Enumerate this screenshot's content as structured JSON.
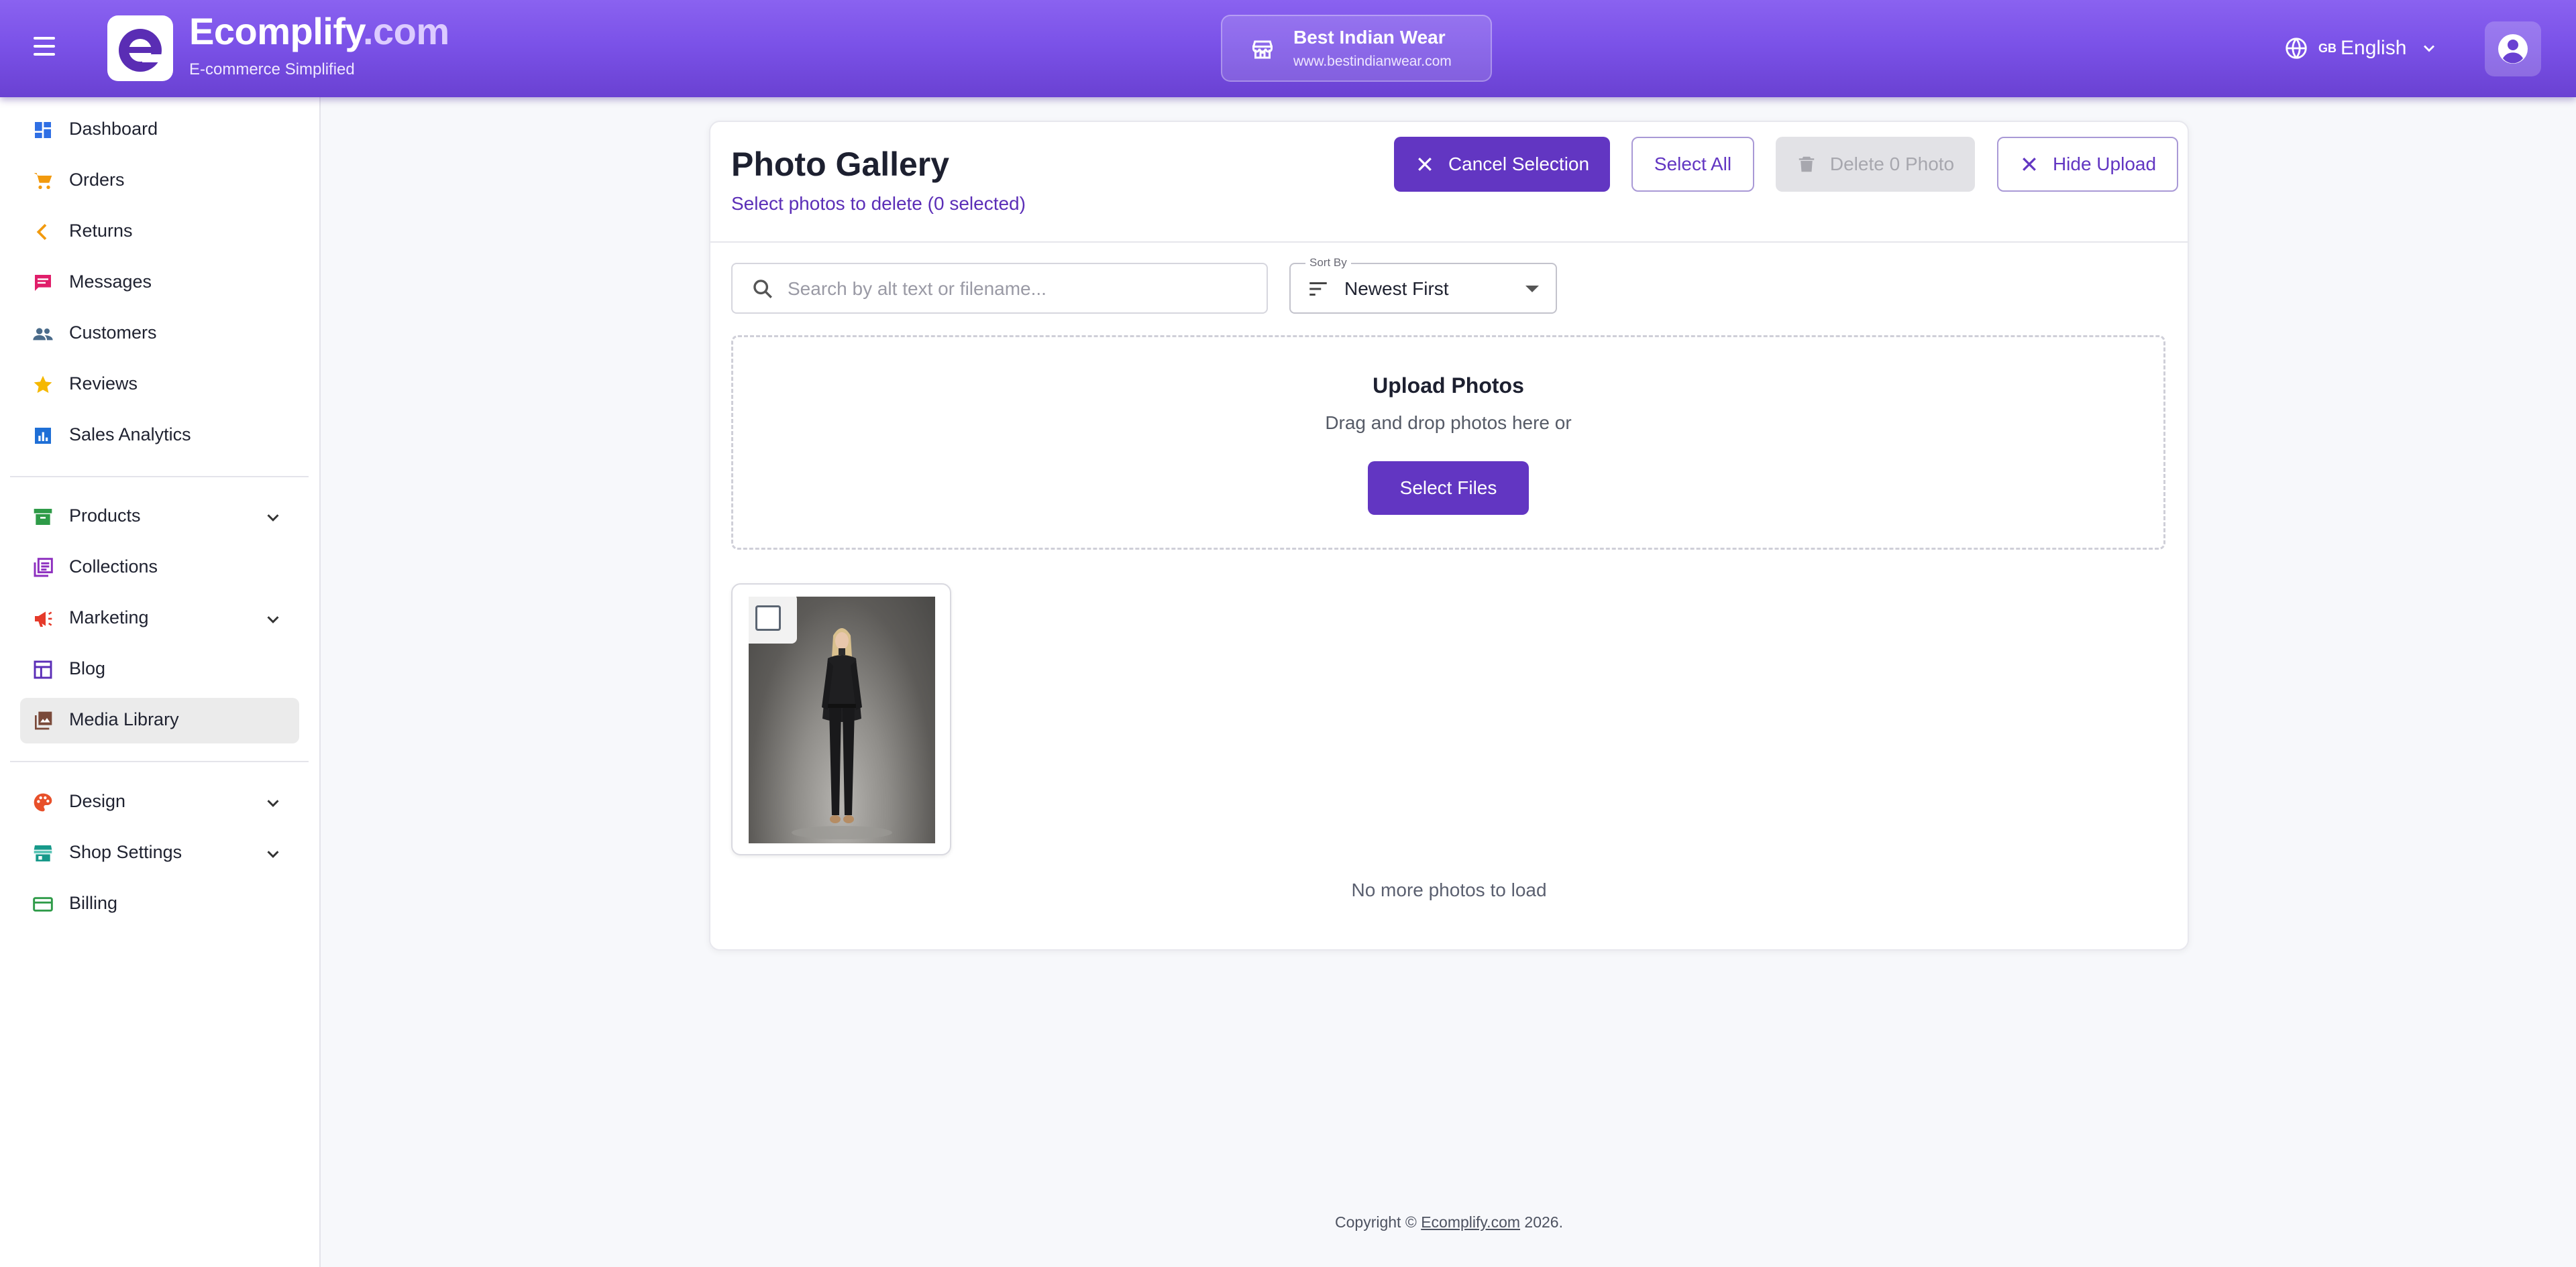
{
  "header": {
    "brand_main": "Ecomplify",
    "brand_domain": ".com",
    "tagline": "E-commerce Simplified",
    "store_name": "Best Indian Wear",
    "store_url": "www.bestindianwear.com",
    "language_flag": "GB",
    "language": "English",
    "icons": [
      "menu-icon",
      "logo-icon",
      "store-icon",
      "globe-icon",
      "chevron-down-icon",
      "account-circle-icon"
    ]
  },
  "sidebar": {
    "items": [
      {
        "label": "Dashboard",
        "icon": "dashboard-icon"
      },
      {
        "label": "Orders",
        "icon": "cart-icon"
      },
      {
        "label": "Returns",
        "icon": "chevron-left-icon"
      },
      {
        "label": "Messages",
        "icon": "message-icon"
      },
      {
        "label": "Customers",
        "icon": "people-icon"
      },
      {
        "label": "Reviews",
        "icon": "star-icon"
      },
      {
        "label": "Sales Analytics",
        "icon": "bar-chart-icon"
      },
      {
        "label": "Products",
        "icon": "archive-icon",
        "expandable": true
      },
      {
        "label": "Collections",
        "icon": "collections-icon"
      },
      {
        "label": "Marketing",
        "icon": "megaphone-icon",
        "expandable": true
      },
      {
        "label": "Blog",
        "icon": "blog-icon"
      },
      {
        "label": "Media Library",
        "icon": "photo-library-icon",
        "active": true
      },
      {
        "label": "Design",
        "icon": "palette-icon",
        "expandable": true
      },
      {
        "label": "Shop Settings",
        "icon": "storefront-icon",
        "expandable": true
      },
      {
        "label": "Billing",
        "icon": "credit-card-icon"
      }
    ]
  },
  "gallery": {
    "title": "Photo Gallery",
    "subtitle": "Select photos to delete (0 selected)",
    "cancel_label": "Cancel Selection",
    "select_all_label": "Select All",
    "delete_label": "Delete 0 Photo",
    "hide_upload_label": "Hide Upload",
    "search_placeholder": "Search by alt text or filename...",
    "sort_label": "Sort By",
    "sort_value": "Newest First",
    "upload_title": "Upload Photos",
    "upload_sub": "Drag and drop photos here or",
    "select_files_label": "Select Files",
    "no_more": "No more photos to load",
    "photos": [
      {
        "selected": false,
        "description": "woman-in-black-suit"
      }
    ]
  },
  "footer": {
    "prefix": "Copyright © ",
    "link": "Ecomplify.com",
    "suffix": " 2026."
  },
  "colors": {
    "header_gradient_start": "#8a62f0",
    "header_gradient_end": "#6a41d2",
    "primary": "#6236c2",
    "active_nav_bg": "#ebebeb"
  }
}
